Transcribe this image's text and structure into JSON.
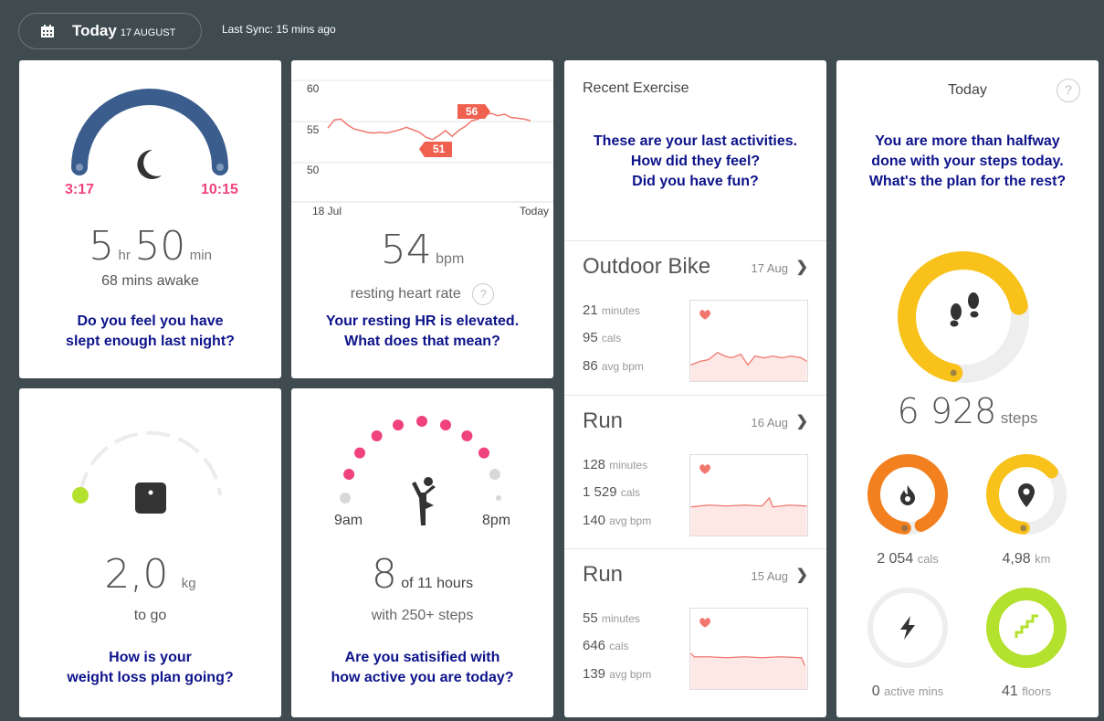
{
  "header": {
    "today_label": "Today",
    "date": "17 AUGUST",
    "sync": "Last Sync: 15 mins ago"
  },
  "sleep": {
    "start": "3:17",
    "end": "10:15",
    "hours": "5",
    "hr_unit": "hr",
    "minutes": "50",
    "min_unit": "min",
    "awake": "68 mins awake",
    "question": [
      "Do you feel you have",
      "slept enough last night?"
    ]
  },
  "heart": {
    "y_ticks": [
      "60",
      "55",
      "50"
    ],
    "x_start": "18 Jul",
    "x_end": "Today",
    "high_label": "56",
    "low_label": "51",
    "value": "54",
    "unit": "bpm",
    "caption": "resting heart rate",
    "question": [
      "Your resting HR is elevated.",
      "What does that mean?"
    ]
  },
  "exercise": {
    "title": "Recent Exercise",
    "question": [
      "These are your last activities.",
      "How did they feel?",
      "Did you have fun?"
    ],
    "items": [
      {
        "name": "Outdoor Bike",
        "date": "17 Aug",
        "minutes": "21",
        "minutes_unit": "minutes",
        "cals": "95",
        "cals_unit": "cals",
        "bpm": "86",
        "bpm_unit": "avg bpm"
      },
      {
        "name": "Run",
        "date": "16 Aug",
        "minutes": "128",
        "minutes_unit": "minutes",
        "cals": "1 529",
        "cals_unit": "cals",
        "bpm": "140",
        "bpm_unit": "avg bpm"
      },
      {
        "name": "Run",
        "date": "15 Aug",
        "minutes": "55",
        "minutes_unit": "minutes",
        "cals": "646",
        "cals_unit": "cals",
        "bpm": "139",
        "bpm_unit": "avg bpm"
      }
    ]
  },
  "steps": {
    "title": "Today",
    "help": "?",
    "question": [
      "You are more than halfway",
      "done with your steps today.",
      "What's the plan for the rest?"
    ],
    "value": "6 928",
    "unit": "steps",
    "progress": 0.69,
    "cals": {
      "value": "2 054",
      "unit": "cals",
      "progress": 0.92
    },
    "distance": {
      "value": "4,98",
      "unit": "km",
      "progress": 0.62
    },
    "active": {
      "value": "0",
      "unit": "active mins",
      "progress": 0
    },
    "floors": {
      "value": "41",
      "unit": "floors",
      "progress": 1
    }
  },
  "weight": {
    "value": "2,0",
    "unit": "kg",
    "caption": "to go",
    "question": [
      "How is your",
      "weight loss plan going?"
    ]
  },
  "hourly": {
    "start": "9am",
    "end": "8pm",
    "value": "8",
    "of_text": "of 11 hours",
    "caption": "with 250+ steps",
    "question": [
      "Are you satisified with",
      "how active you are today?"
    ]
  },
  "colors": {
    "background": "#3f4b4f",
    "question": "#0d138a",
    "sleep_arc": "#3a5d8e",
    "pink": "#f0437d",
    "heart_line": "#f0776e",
    "steps_yellow": "#f8c21b",
    "cals_orange": "#f2801f",
    "lime": "#b3e12e"
  },
  "icons": [
    "calendar-icon",
    "moon-icon",
    "help-icon",
    "heart-icon",
    "chevron-right-icon",
    "footsteps-icon",
    "flame-icon",
    "location-pin-icon",
    "bolt-icon",
    "stairs-icon",
    "scale-icon",
    "person-icon"
  ]
}
